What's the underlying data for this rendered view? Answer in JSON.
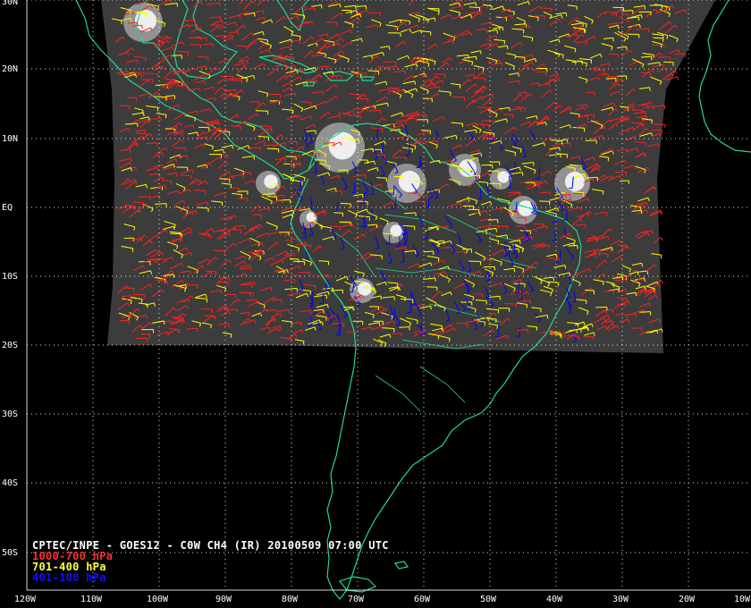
{
  "map": {
    "title": "CPTEC/INPE - GOES12 - C0W CH4 (IR) 20100509 07:00 UTC",
    "legend": [
      {
        "label": "1000-700 hPa",
        "color": "#ff2020",
        "key": "low"
      },
      {
        "label": "701-400 hPa",
        "color": "#ffff00",
        "key": "mid"
      },
      {
        "label": "401-100 hPa",
        "color": "#0000ff",
        "key": "high"
      }
    ],
    "lat_labels": [
      "30N",
      "20N",
      "10N",
      "EQ",
      "10S",
      "20S",
      "30S",
      "40S",
      "50S"
    ],
    "lon_labels": [
      "120W",
      "110W",
      "100W",
      "90W",
      "80W",
      "70W",
      "60W",
      "50W",
      "40W",
      "30W",
      "20W",
      "10W"
    ],
    "colors": {
      "background": "#000000",
      "coastline": "#20d890",
      "grid": "#ffffff",
      "imagery": "#3c3c3c"
    }
  }
}
